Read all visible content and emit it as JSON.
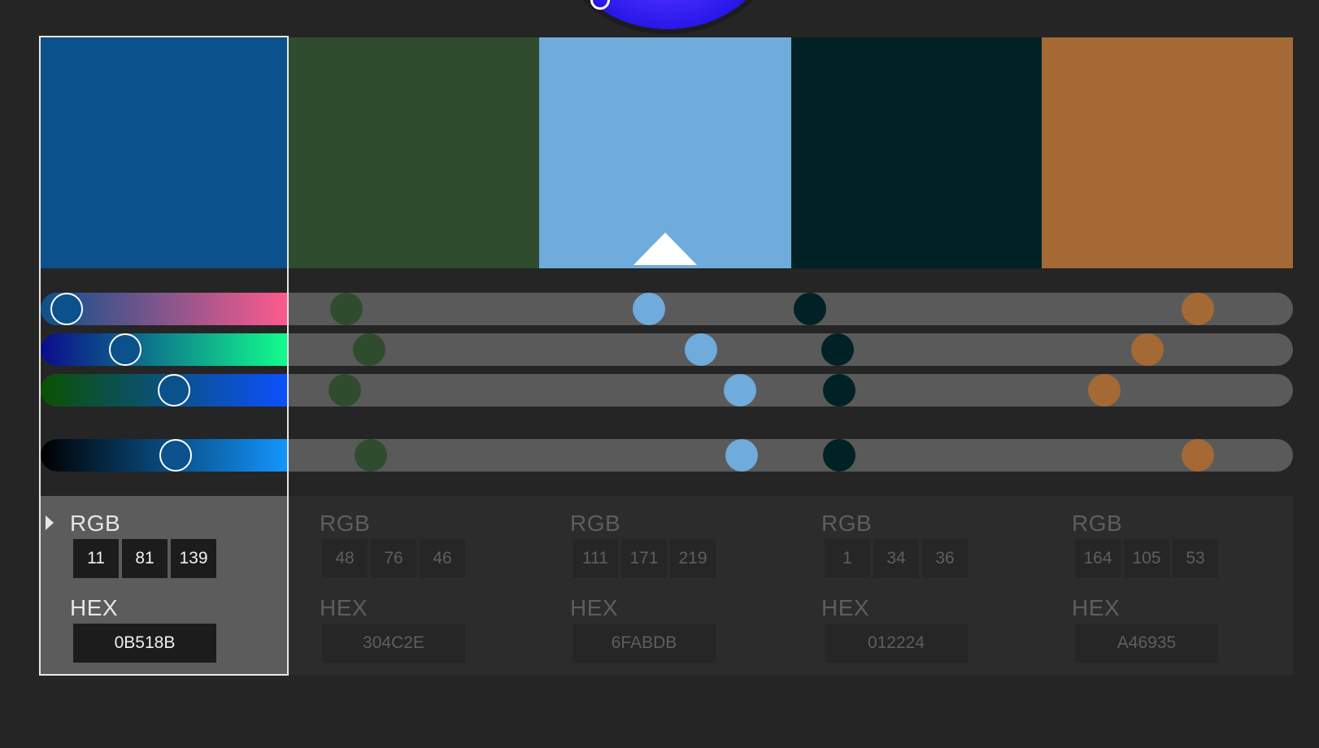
{
  "swatches": [
    {
      "color": "#0B518B",
      "rgb": [
        "11",
        "81",
        "139"
      ],
      "hex": "0B518B"
    },
    {
      "color": "#304C2E",
      "rgb": [
        "48",
        "76",
        "46"
      ],
      "hex": "304C2E"
    },
    {
      "color": "#6FABDB",
      "rgb": [
        "111",
        "171",
        "219"
      ],
      "hex": "6FABDB"
    },
    {
      "color": "#012224",
      "rgb": [
        "1",
        "34",
        "36"
      ],
      "hex": "012224"
    },
    {
      "color": "#A46935",
      "rgb": [
        "164",
        "105",
        "53"
      ],
      "hex": "A46935"
    }
  ],
  "labels": {
    "rgb": "RGB",
    "hex": "HEX"
  },
  "active_index": 0,
  "base_swatch_index": 2,
  "sliders": [
    {
      "name": "slider-1",
      "gradient": [
        "#0B518B",
        "#FF5A8C"
      ]
    },
    {
      "name": "slider-2",
      "gradient": [
        "#0B0B8C",
        "#12FF8C"
      ]
    },
    {
      "name": "slider-3",
      "gradient": [
        "#0B5100",
        "#0B51FF"
      ]
    },
    {
      "name": "slider-brightness",
      "gradient": [
        "#000000",
        "#1396FF"
      ]
    }
  ],
  "icons": {
    "expander": "triangle-right-icon",
    "base": "base-color-triangle-icon",
    "wheel": "color-wheel"
  }
}
